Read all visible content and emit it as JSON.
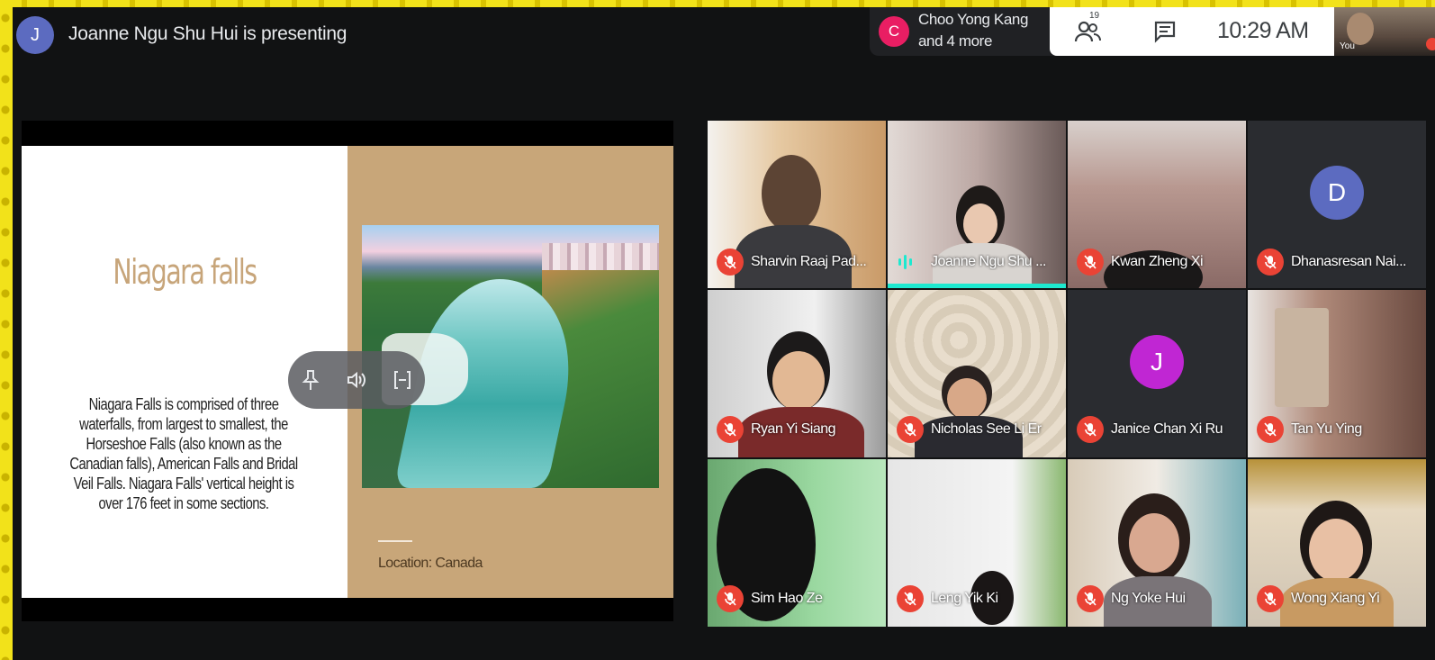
{
  "presenter": {
    "initial": "J",
    "text": "Joanne Ngu Shu Hui is presenting"
  },
  "participants_chip": {
    "initial": "C",
    "line1": "Choo Yong Kang",
    "line2": "and 4 more"
  },
  "toolbar": {
    "people_count": "19",
    "time": "10:29 AM"
  },
  "self": {
    "label": "You"
  },
  "slide": {
    "title": "Niagara falls",
    "body": "Niagara Falls is comprised of three waterfalls, from largest to smallest, the Horseshoe Falls (also known as the Canadian falls), American Falls and Bridal Veil Falls. Niagara Falls' vertical height is over 176 feet in some sections.",
    "caption": "Location: Canada"
  },
  "tiles": [
    {
      "name": "Sharvin Raaj Pad...",
      "muted": true
    },
    {
      "name": "Joanne Ngu Shu ...",
      "muted": false,
      "speaking": true
    },
    {
      "name": "Kwan Zheng Xi",
      "muted": true
    },
    {
      "name": "Dhanasresan Nai...",
      "muted": true,
      "initial": "D",
      "avatar_color": "#5c6bc0"
    },
    {
      "name": "Ryan Yi Siang",
      "muted": true
    },
    {
      "name": "Nicholas See Li Er",
      "muted": true
    },
    {
      "name": "Janice Chan Xi Ru",
      "muted": true,
      "initial": "J",
      "avatar_color": "#c026d3"
    },
    {
      "name": "Tan Yu Ying",
      "muted": true
    },
    {
      "name": "Sim Hao Ze",
      "muted": true
    },
    {
      "name": "Leng Yik Ki",
      "muted": true
    },
    {
      "name": "Ng Yoke Hui",
      "muted": true
    },
    {
      "name": "Wong Xiang Yi",
      "muted": true
    }
  ],
  "colors": {
    "accent_speaking": "#1de9d0",
    "mic_off": "#ea4335",
    "slide_tan": "#c8a679"
  }
}
